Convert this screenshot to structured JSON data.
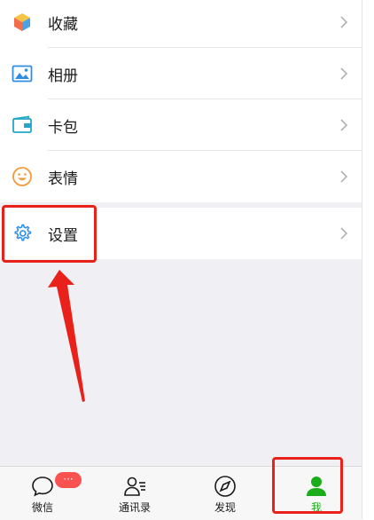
{
  "colors": {
    "accent": "#1aad19",
    "annotation_red": "#e8221b",
    "badge_red": "#fa5151",
    "background": "#efeff4"
  },
  "menu": {
    "items": [
      {
        "label": "收藏",
        "icon": "cube-icon"
      },
      {
        "label": "相册",
        "icon": "image-icon"
      },
      {
        "label": "卡包",
        "icon": "card-icon"
      },
      {
        "label": "表情",
        "icon": "smile-icon"
      }
    ],
    "settings": {
      "label": "设置",
      "icon": "gear-icon"
    }
  },
  "tabbar": {
    "tabs": [
      {
        "label": "微信",
        "icon": "chat-bubble-icon",
        "badge": "···"
      },
      {
        "label": "通讯录",
        "icon": "contacts-icon"
      },
      {
        "label": "发现",
        "icon": "compass-icon"
      },
      {
        "label": "我",
        "icon": "person-icon",
        "active": true
      }
    ]
  }
}
